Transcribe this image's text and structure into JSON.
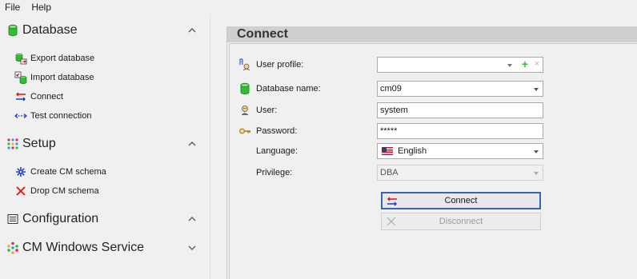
{
  "menu": {
    "file": "File",
    "help": "Help"
  },
  "sidebar": {
    "database": {
      "title": "Database",
      "items": [
        "Export database",
        "Import database",
        "Connect",
        "Test connection"
      ]
    },
    "setup": {
      "title": "Setup",
      "items": [
        "Create CM schema",
        "Drop CM schema"
      ]
    },
    "configuration": {
      "title": "Configuration"
    },
    "service": {
      "title": "CM Windows Service"
    }
  },
  "panel": {
    "title": "Connect",
    "fields": {
      "user_profile": {
        "label": "User profile:",
        "value": ""
      },
      "database_name": {
        "label": "Database name:",
        "value": "cm09"
      },
      "user": {
        "label": "User:",
        "value": "system"
      },
      "password": {
        "label": "Password:",
        "value": "*****"
      },
      "language": {
        "label": "Language:",
        "value": "English"
      },
      "privilege": {
        "label": "Privilege:",
        "value": "DBA"
      }
    },
    "buttons": {
      "connect": "Connect",
      "disconnect": "Disconnect"
    }
  },
  "colors": {
    "accent": "#3e64b1",
    "db_green": "#2fbf2f",
    "header": "#cfcfcf"
  },
  "icons": {
    "database": "database-icon",
    "export": "export-database-icon",
    "import": "import-database-icon",
    "connect": "connect-icon",
    "test": "test-connection-icon",
    "setup": "setup-icon",
    "create": "create-schema-icon",
    "drop": "drop-schema-icon",
    "configuration": "configuration-icon",
    "service": "service-icon"
  }
}
